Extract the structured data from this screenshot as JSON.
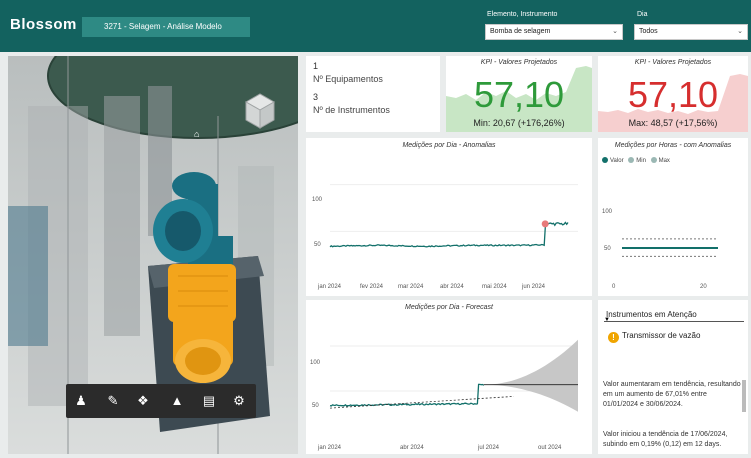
{
  "header": {
    "logo": "Blossom",
    "title": "3271 - Selagem - Análise Modelo",
    "filter_elemento_label": "Elemento, Instrumento",
    "filter_elemento_value": "Bomba de selagem",
    "filter_dia_label": "Dia",
    "filter_dia_value": "Todos"
  },
  "viewer": {
    "tools": [
      "person-icon",
      "pencil-icon",
      "cube-icon",
      "hierarchy-icon",
      "properties-icon",
      "gear-icon"
    ],
    "colors": {
      "pump_body": "#1a6f82",
      "motor": "#f3a51c",
      "base": "#3d4a52"
    }
  },
  "counts": {
    "equipamentos_value": "1",
    "equipamentos_label": "Nº Equipamentos",
    "instrumentos_value": "3",
    "instrumentos_label": "Nº de Instrumentos"
  },
  "kpi_left": {
    "title": "KPI - Valores Projetados",
    "value": "57,10",
    "sub": "Min: 20,67 (+176,26%)",
    "color": "#2e9a3a"
  },
  "kpi_right": {
    "title": "KPI - Valores Projetados",
    "value": "57,10",
    "sub": "Max: 48,57 (+17,56%)",
    "color": "#d62e2e"
  },
  "chart_anomalias": {
    "title": "Medições por Dia - Anomalias",
    "y_ticks": [
      "100",
      "50"
    ],
    "x_ticks": [
      "jan 2024",
      "fev 2024",
      "mar 2024",
      "abr 2024",
      "mai 2024",
      "jun 2024"
    ]
  },
  "chart_horas": {
    "title": "Medições por Horas - com Anomalias",
    "legend": [
      "Valor",
      "Min",
      "Max"
    ],
    "y_ticks": [
      "100",
      "50"
    ],
    "x_ticks": [
      "0",
      "20"
    ]
  },
  "chart_forecast": {
    "title": "Medições por Dia - Forecast",
    "y_ticks": [
      "100",
      "50"
    ],
    "x_ticks": [
      "jan 2024",
      "abr 2024",
      "jul 2024",
      "out 2024"
    ]
  },
  "atencao": {
    "title": "Instrumentos em Atenção",
    "item": "Transmissor de vazão",
    "text1": "Valor aumentaram em tendência, resultando em um aumento de 67,01% entre 01/01/2024 e 30/06/2024.",
    "text2": "Valor iniciou a tendência de 17/06/2024, subindo em 0,19% (0,12) em 12 days."
  },
  "chart_data": [
    {
      "type": "line",
      "title": "Medições por Dia - Anomalias",
      "x": [
        "jan 2024",
        "fev 2024",
        "mar 2024",
        "abr 2024",
        "mai 2024",
        "jun 2024"
      ],
      "series": [
        {
          "values": [
            34,
            35,
            34,
            35,
            35,
            36,
            58
          ]
        }
      ],
      "ylim": [
        0,
        120
      ],
      "anomaly_points": [
        {
          "x": "jun 2024",
          "y": 58
        }
      ]
    },
    {
      "type": "line",
      "title": "Medições por Horas - com Anomalias",
      "x": [
        0,
        20
      ],
      "series": [
        {
          "name": "Valor",
          "values": [
            36,
            36
          ]
        },
        {
          "name": "Min",
          "values": [
            26,
            26
          ]
        },
        {
          "name": "Max",
          "values": [
            47,
            47
          ]
        }
      ],
      "ylim": [
        0,
        120
      ]
    },
    {
      "type": "line",
      "title": "Medições por Dia - Forecast",
      "x": [
        "jan 2024",
        "abr 2024",
        "jul 2024",
        "out 2024"
      ],
      "series": [
        {
          "values": [
            34,
            36,
            57,
            57
          ]
        }
      ],
      "ylim": [
        0,
        120
      ]
    }
  ],
  "colors": {
    "header": "#13625f",
    "series": "#12706a",
    "anomaly": "#e77a7a"
  }
}
